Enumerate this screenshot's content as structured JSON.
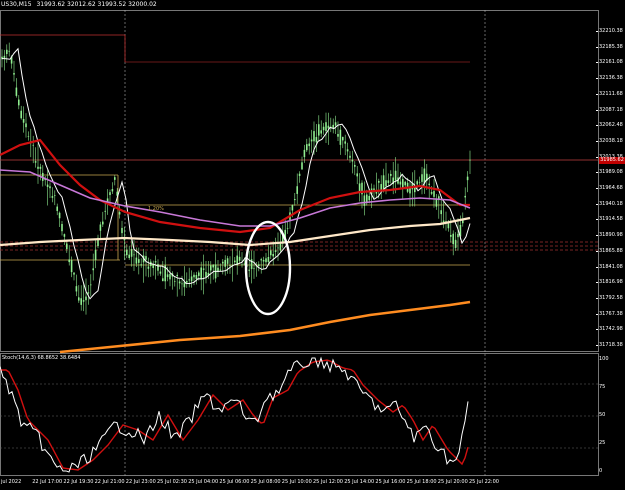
{
  "chart": {
    "symbol": "US30,M15",
    "ohlc": "31993.62 32012.62 31993.52 32000.02",
    "current_price": "31985.62",
    "price_ticks": [
      "32210.38",
      "32185.38",
      "32161.08",
      "32136.38",
      "32111.68",
      "32087.18",
      "32062.48",
      "32038.18",
      "32013.38",
      "31989.08",
      "31964.68",
      "31940.18",
      "31914.58",
      "31890.98",
      "31865.88",
      "31841.08",
      "31816.98",
      "31792.58",
      "31767.38",
      "31742.98",
      "31718.38"
    ],
    "oscillator_label": "Stoch(14,6,3) 68.8652 38.6484",
    "osc_ticks": [
      "100",
      "75",
      "50",
      "25",
      "0"
    ],
    "time_ticks": [
      "jul 2022",
      "22 Jul 17:00",
      "22 Jul 19:30",
      "22 Jul 21:00",
      "22 Jul 23:00",
      "25 Jul 02:30",
      "25 Jul 04:00",
      "25 Jul 06:00",
      "25 Jul 08:00",
      "25 Jul 10:00",
      "25 Jul 12:00",
      "25 Jul 14:00",
      "25 Jul 16:00",
      "25 Jul 18:00",
      "25 Jul 20:00",
      "25 Jul 22:00"
    ],
    "colors": {
      "background": "#000000",
      "candles": "#90ee90",
      "ma_fast": "#ffffff",
      "ma_red": "#d01010",
      "ma_violet": "#c878d8",
      "ma_cream": "#ffe8c8",
      "ma_orange": "#ff8c20",
      "stoch_main": "#ffffff",
      "stoch_signal": "#d01010",
      "highlight_circle": "#ffffff"
    },
    "annotations": [
      "1.20%"
    ]
  }
}
